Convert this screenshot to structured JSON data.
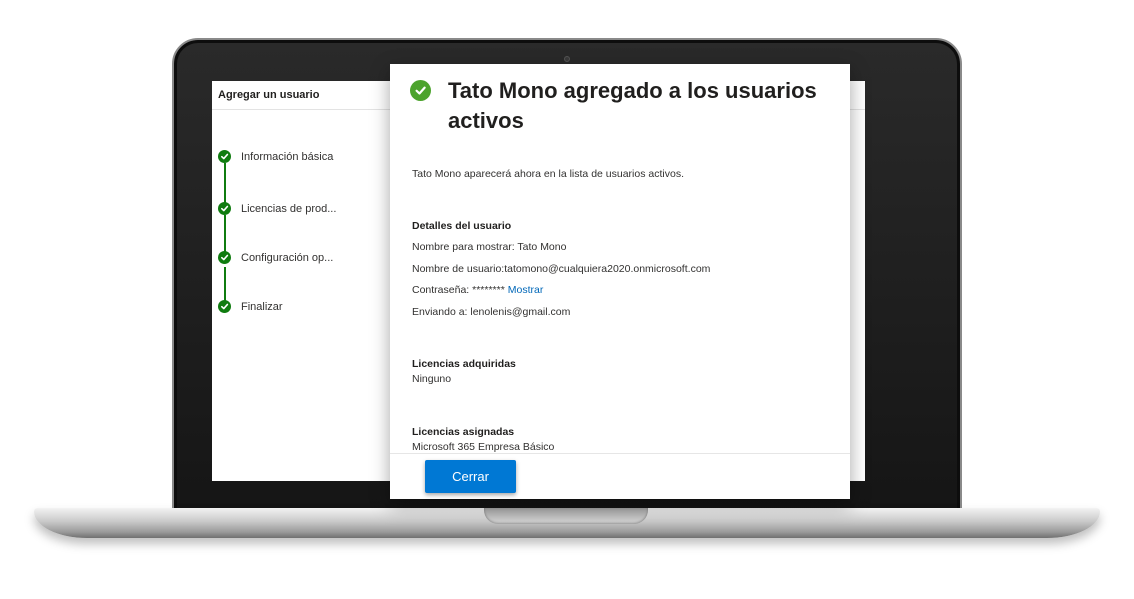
{
  "wizard": {
    "title": "Agregar un usuario",
    "steps": [
      {
        "label": "Información básica",
        "status": "completed"
      },
      {
        "label": "Licencias de prod...",
        "status": "completed"
      },
      {
        "label": "Configuración op...",
        "status": "completed"
      },
      {
        "label": "Finalizar",
        "status": "completed"
      }
    ]
  },
  "dialog": {
    "status_icon": "check-circle-icon",
    "title": "Tato Mono agregado a los usuarios activos",
    "description": "Tato Mono aparecerá ahora en la lista de usuarios activos.",
    "user_details": {
      "heading": "Detalles del usuario",
      "display_name": "Nombre para mostrar: Tato Mono",
      "username": "Nombre de usuario:tatomono@cualquiera2020.onmicrosoft.com",
      "password_label": "Contraseña: ********",
      "password_show_link": "Mostrar",
      "sending_to": "Enviando a: lenolenis@gmail.com"
    },
    "acquired_licenses": {
      "heading": "Licencias adquiridas",
      "value": "Ninguno"
    },
    "assigned_licenses": {
      "heading": "Licencias asignadas",
      "value": "Microsoft 365 Empresa Básico"
    },
    "close_button": "Cerrar"
  },
  "colors": {
    "success_green": "#107c10",
    "primary_blue": "#0078d4",
    "link_blue": "#0067b8"
  }
}
